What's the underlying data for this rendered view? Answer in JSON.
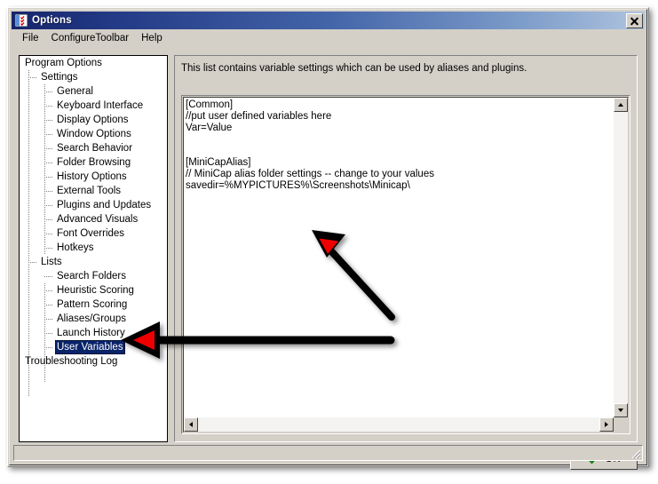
{
  "window": {
    "title": "Options",
    "icon": "options-checklist-icon",
    "close_label": "x"
  },
  "menubar": {
    "items": [
      {
        "label": "File"
      },
      {
        "label": "ConfigureToolbar"
      },
      {
        "label": "Help"
      }
    ]
  },
  "tree": {
    "nodes": [
      {
        "label": "Program Options",
        "level": 0,
        "selected": false
      },
      {
        "label": "Settings",
        "level": 1,
        "selected": false
      },
      {
        "label": "General",
        "level": 2,
        "selected": false
      },
      {
        "label": "Keyboard Interface",
        "level": 2,
        "selected": false
      },
      {
        "label": "Display Options",
        "level": 2,
        "selected": false
      },
      {
        "label": "Window Options",
        "level": 2,
        "selected": false
      },
      {
        "label": "Search Behavior",
        "level": 2,
        "selected": false
      },
      {
        "label": "Folder Browsing",
        "level": 2,
        "selected": false
      },
      {
        "label": "History Options",
        "level": 2,
        "selected": false
      },
      {
        "label": "External Tools",
        "level": 2,
        "selected": false
      },
      {
        "label": "Plugins and Updates",
        "level": 2,
        "selected": false
      },
      {
        "label": "Advanced Visuals",
        "level": 2,
        "selected": false
      },
      {
        "label": "Font Overrides",
        "level": 2,
        "selected": false
      },
      {
        "label": "Hotkeys",
        "level": 2,
        "selected": false
      },
      {
        "label": "Lists",
        "level": 1,
        "selected": false
      },
      {
        "label": "Search Folders",
        "level": 2,
        "selected": false
      },
      {
        "label": "Heuristic Scoring",
        "level": 2,
        "selected": false
      },
      {
        "label": "Pattern Scoring",
        "level": 2,
        "selected": false
      },
      {
        "label": "Aliases/Groups",
        "level": 2,
        "selected": false
      },
      {
        "label": "Launch History",
        "level": 2,
        "selected": false
      },
      {
        "label": "User Variables",
        "level": 2,
        "selected": true
      },
      {
        "label": "Troubleshooting Log",
        "level": 0,
        "selected": false
      }
    ]
  },
  "panel": {
    "description": "This list contains variable settings which can be used by aliases and plugins.",
    "editor_value": "[Common]\n//put user defined variables here\nVar=Value\n\n\n[MiniCapAlias]\n// MiniCap alias folder settings -- change to your values\nsavedir=%MYPICTURES%\\Screenshots\\Minicap\\"
  },
  "buttons": {
    "ok_label": "OK",
    "ok_icon": "green-checkmark-icon"
  },
  "statusbar": {
    "text": ""
  },
  "annotations": [
    {
      "name": "arrow-to-editor",
      "kind": "red-tipped-black-arrow"
    },
    {
      "name": "arrow-to-user-variables",
      "kind": "red-tipped-black-arrow"
    }
  ],
  "colors": {
    "titlebar_start": "#16246b",
    "titlebar_end": "#afc4df",
    "window_face": "#d4d0c8",
    "selection": "#0a246a",
    "annotation_red": "#ee0000",
    "ok_check_green": "#00a000"
  }
}
